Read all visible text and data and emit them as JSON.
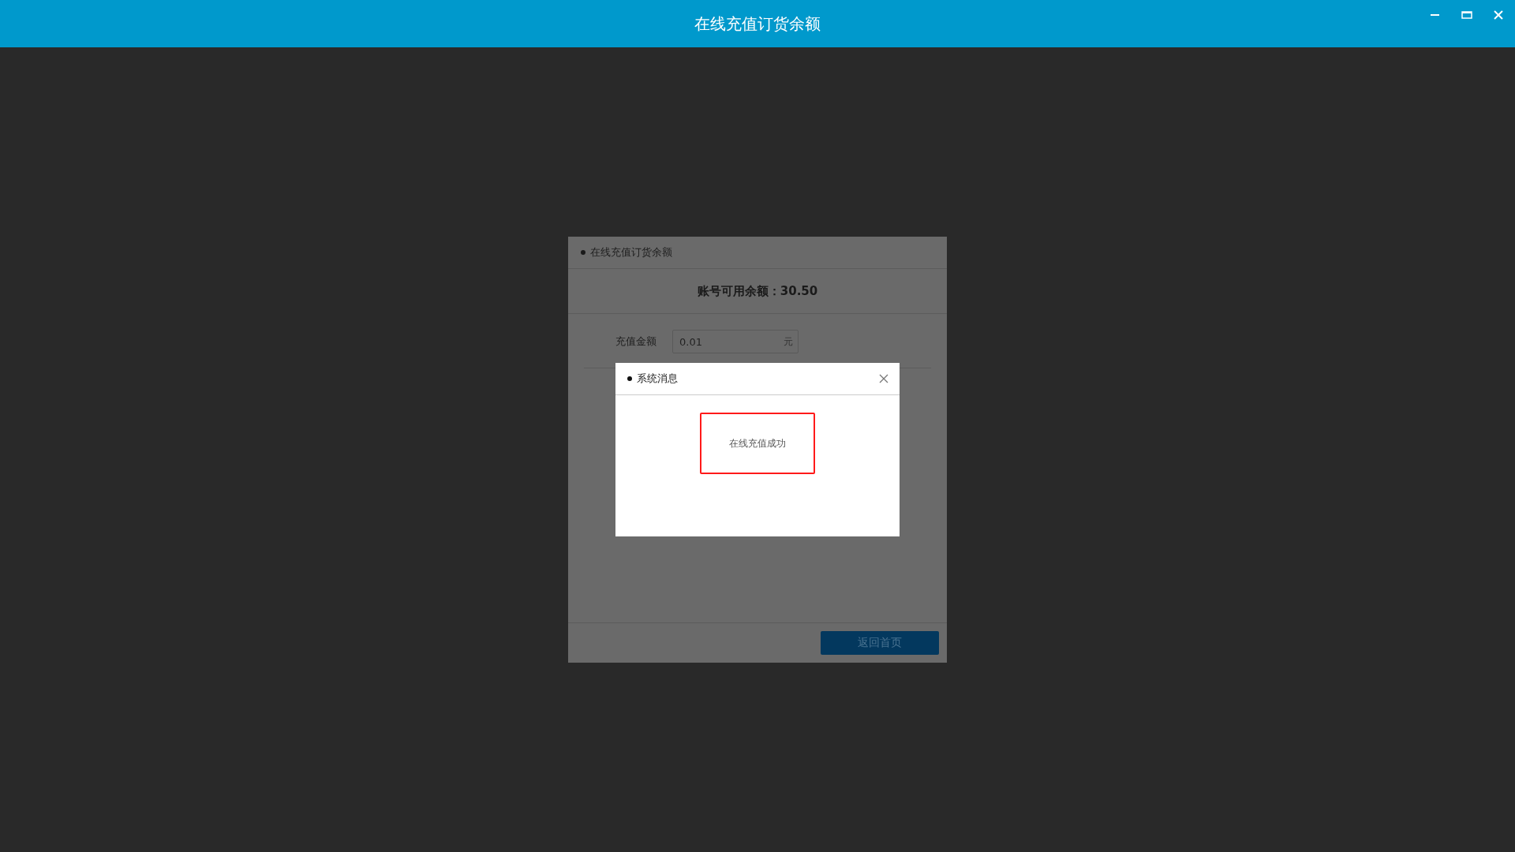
{
  "window": {
    "title": "在线充值订货余额"
  },
  "panel": {
    "title": "在线充值订货余额",
    "balance_label": "账号可用余额：",
    "balance": "30.50",
    "amount_label": "充值金额",
    "amount": {
      "value": "0.01",
      "unit": "元"
    },
    "return_button": "返回首页"
  },
  "message_dialog": {
    "title": "系统消息",
    "message": "在线充值成功"
  }
}
